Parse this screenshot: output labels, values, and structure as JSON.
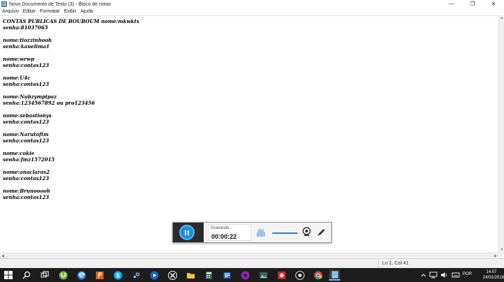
{
  "window": {
    "title": "Novo Documento de Texto (3) - Bloco de notas",
    "minimize_glyph": "—",
    "restore_glyph": "❐",
    "close_glyph": "✕"
  },
  "menu": [
    "Arquivo",
    "Editar",
    "Formatar",
    "Exibir",
    "Ajuda"
  ],
  "document": {
    "lines": [
      "CONTAS PUBLICAS DE BOUBOUM nome:mkwktx",
      "senha:81037065",
      "",
      "nome:tiozzinhooh",
      "senha:kauelima1",
      "",
      "nome:wrwp",
      "senha:contas123",
      "",
      "nome:U4c",
      "senha:contas123",
      "",
      "nome:Nubzympipaz",
      "senha:1234567892 ou pro123456",
      "",
      "nome:sebastionys",
      "senha:contas123",
      "",
      "nome:Narutoftm",
      "senha:contas123",
      "",
      "nome:cokie",
      "senha:fmz1572015",
      "",
      "nome:anaclaras2",
      "senha:contas123",
      "",
      "nome:Brunooooh",
      "senha:contas123"
    ]
  },
  "statusbar": {
    "position": "Ln 1, Col 41"
  },
  "recorder": {
    "status": "Gravando...",
    "elapsed": "00:00:22",
    "volume_level": 1.0
  },
  "taskbar": {
    "apps": [
      "start",
      "search",
      "task-view",
      "utorrent",
      "edge",
      "burp",
      "skype",
      "steam",
      "media-player",
      "xbox",
      "explorer",
      "calculator",
      "notepad-alt",
      "chrome",
      "notepad"
    ],
    "language": "POR",
    "time": "14:07",
    "date": "24/01/2016"
  },
  "colors": {
    "accent": "#1d8fe1",
    "taskbar": "#1c1c1c"
  }
}
